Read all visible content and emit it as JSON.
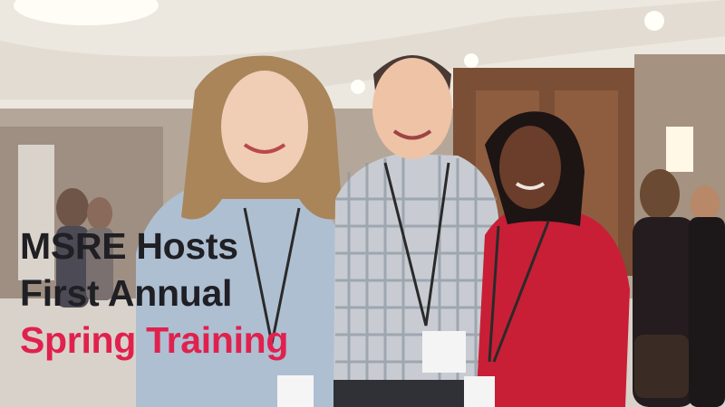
{
  "headline": {
    "line1": "MSRE Hosts",
    "line2": "First Annual",
    "line3": "Spring Training"
  },
  "colors": {
    "headline_dark": "#1f1f24",
    "headline_accent": "#e0214e"
  }
}
